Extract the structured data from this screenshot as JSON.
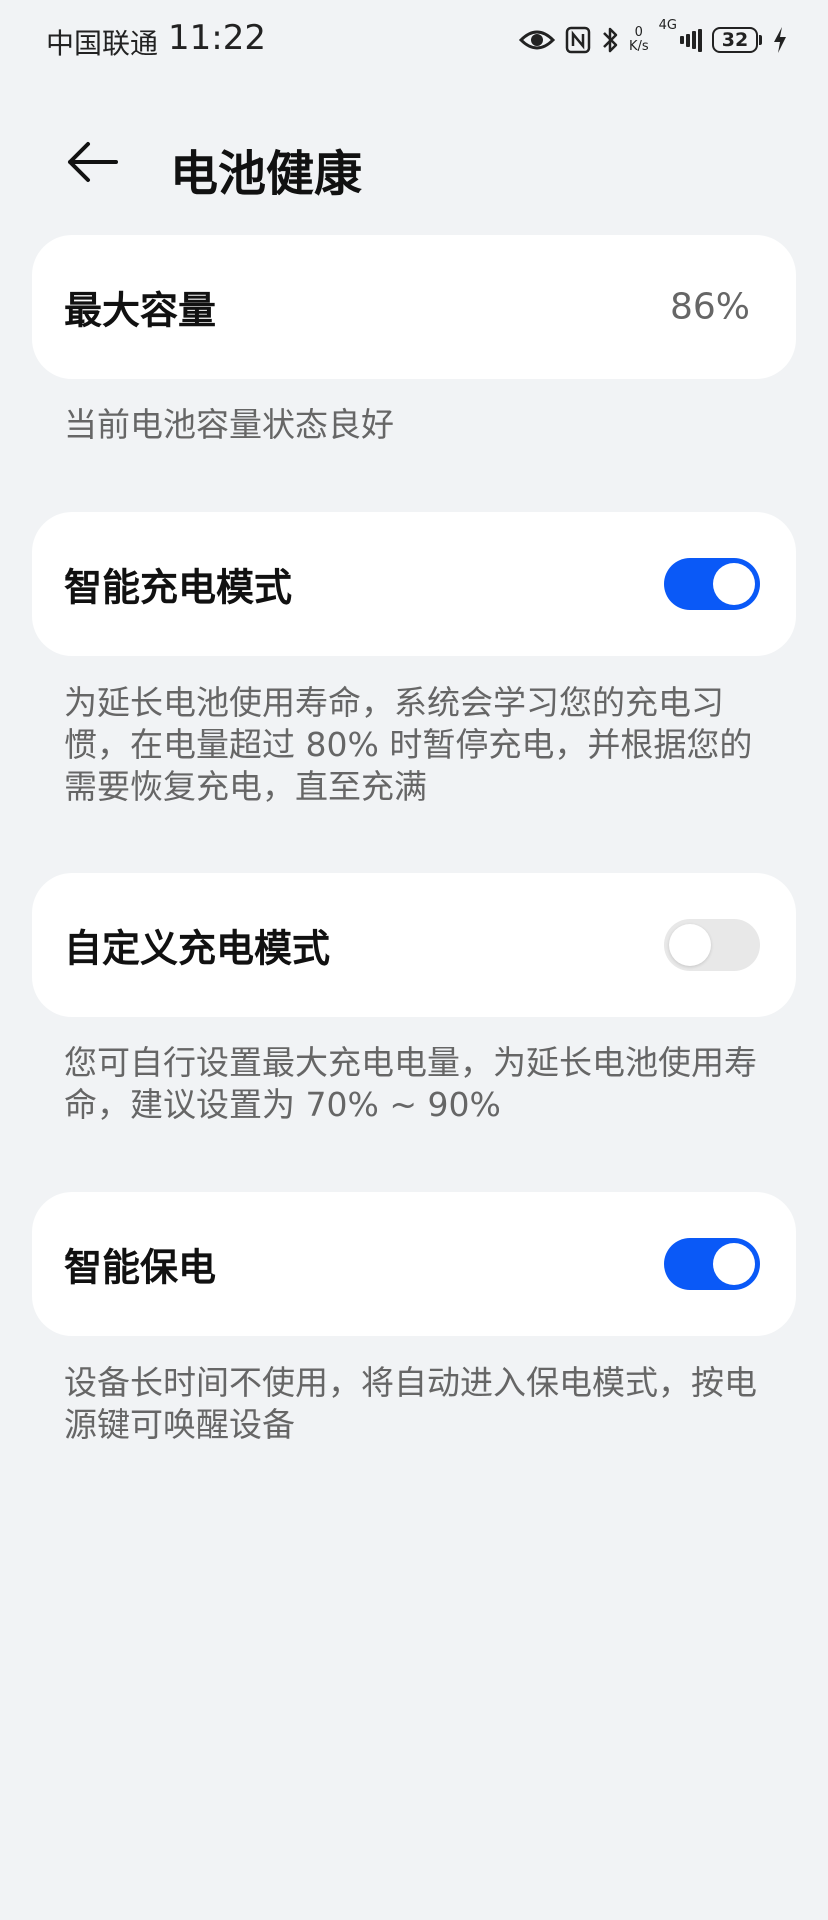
{
  "status_bar": {
    "carrier": "中国联通",
    "time": "11:22",
    "icons": [
      "eye-icon",
      "nfc-icon",
      "bluetooth-icon",
      "net-speed",
      "signal-4g-icon",
      "battery-icon",
      "charging-bolt-icon"
    ],
    "net_speed_value": "0",
    "net_speed_unit": "K/s",
    "network_type": "4G",
    "battery_level": "32"
  },
  "header": {
    "back_icon": "arrow-left-icon",
    "title": "电池健康"
  },
  "items": {
    "max_capacity": {
      "label": "最大容量",
      "value": "86%",
      "description": "当前电池容量状态良好"
    },
    "smart_charging": {
      "label": "智能充电模式",
      "enabled": true,
      "description": "为延长电池使用寿命，系统会学习您的充电习惯，在电量超过 80% 时暂停充电，并根据您的需要恢复充电，直至充满"
    },
    "custom_charging": {
      "label": "自定义充电模式",
      "enabled": false,
      "description": "您可自行设置最大充电电量，为延长电池使用寿命，建议设置为 70% ~ 90%"
    },
    "smart_power_save": {
      "label": "智能保电",
      "enabled": true,
      "description": "设备长时间不使用，将自动进入保电模式，按电源键可唤醒设备"
    }
  },
  "colors": {
    "background": "#f1f3f5",
    "card": "#ffffff",
    "accent": "#0a59f7",
    "toggle_off": "#e8e8e8",
    "secondary_text": "#666666"
  }
}
